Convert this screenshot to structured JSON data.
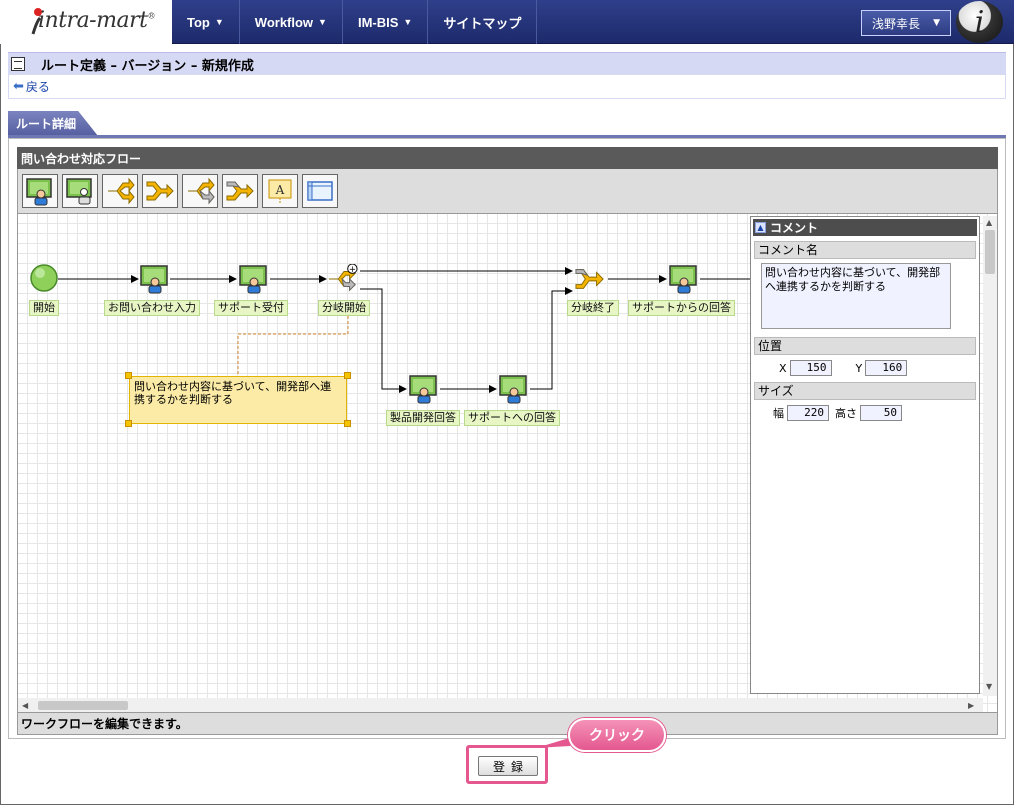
{
  "header": {
    "logo": "intra-mart",
    "nav": [
      {
        "label": "Top",
        "has_caret": true
      },
      {
        "label": "Workflow",
        "has_caret": true
      },
      {
        "label": "IM-BIS",
        "has_caret": true
      },
      {
        "label": "サイトマップ",
        "has_caret": false
      }
    ],
    "user_name": "浅野幸長",
    "avatar_glyph": "i"
  },
  "page": {
    "title": "ルート定義 – バージョン – 新規作成",
    "back_label": "戻る",
    "tab_label": "ルート詳細"
  },
  "flow": {
    "panel_title": "問い合わせ対応フロー",
    "toolbar": [
      {
        "icon": "user-task-icon"
      },
      {
        "icon": "multi-user-task-icon"
      },
      {
        "icon": "branch-start-icon"
      },
      {
        "icon": "branch-end-icon"
      },
      {
        "icon": "branch-start-gray-icon"
      },
      {
        "icon": "branch-end-gray-icon"
      },
      {
        "icon": "text-annotation-icon",
        "glyph": "A"
      },
      {
        "icon": "window-frame-icon"
      }
    ],
    "nodes": {
      "start": "開始",
      "inquiry_input": "お問い合わせ入力",
      "support_accept": "サポート受付",
      "branch_start": "分岐開始",
      "branch_end": "分岐終了",
      "support_answer": "サポートからの回答",
      "product_dev_answer": "製品開発回答",
      "answer_to_support": "サポートへの回答"
    },
    "comment_text": "問い合わせ内容に基づいて、開発部へ連携するかを判断する",
    "status": "ワークフローを編集できます。"
  },
  "properties": {
    "title": "コメント",
    "comment_name_label": "コメント名",
    "comment_value": "問い合わせ内容に基づいて、開発部へ連携するかを判断する",
    "position_label": "位置",
    "x_label": "X",
    "x_value": "150",
    "y_label": "Y",
    "y_value": "160",
    "size_label": "サイズ",
    "width_label": "幅",
    "width_value": "220",
    "height_label": "高さ",
    "height_value": "50"
  },
  "footer": {
    "register_label": "登録",
    "callout_text": "クリック"
  },
  "colors": {
    "header": "#1d2a6b",
    "node_label_bg": "#e8f6c6",
    "comment_bg": "#fbeba6",
    "callout": "#e4588f"
  }
}
